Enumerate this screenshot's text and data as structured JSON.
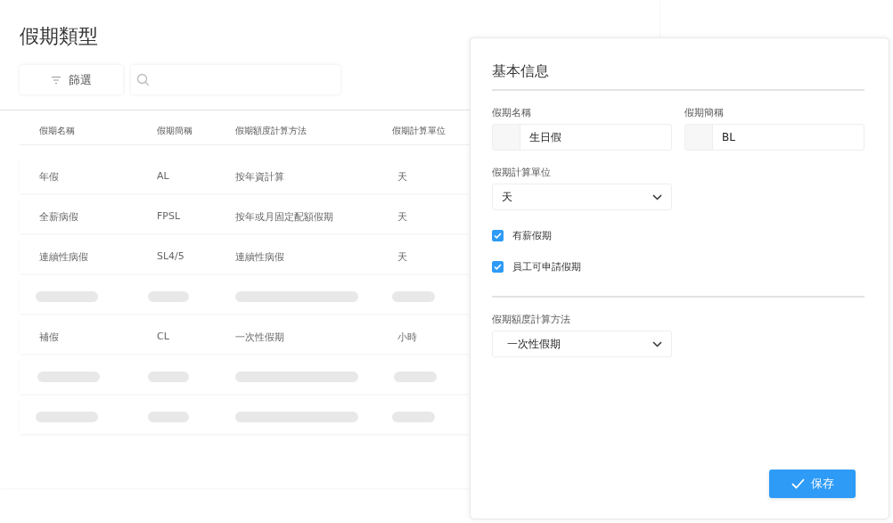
{
  "page": {
    "title": "假期類型",
    "filter_button": "篩選"
  },
  "table": {
    "columns": [
      "假期名稱",
      "假期簡稱",
      "假期額度計算方法",
      "假期計算單位"
    ],
    "rows": [
      {
        "kind": "data",
        "cells": [
          "年假",
          "AL",
          "按年資計算",
          "天"
        ]
      },
      {
        "kind": "data",
        "cells": [
          "全薪病假",
          "FPSL",
          "按年或月固定配額假期",
          "天"
        ]
      },
      {
        "kind": "data",
        "cells": [
          "連續性病假",
          "SL4/5",
          "連續性病假",
          "天"
        ]
      },
      {
        "kind": "skeleton"
      },
      {
        "kind": "data",
        "cells": [
          "補假",
          "CL",
          "一次性假期",
          "小時"
        ]
      },
      {
        "kind": "skeleton"
      },
      {
        "kind": "skeleton"
      }
    ]
  },
  "panel": {
    "title": "基本信息",
    "name_field": {
      "label": "假期名稱",
      "value": "生日假"
    },
    "short_field": {
      "label": "假期簡稱",
      "value": "BL"
    },
    "unit_select": {
      "label": "假期計算單位",
      "value": "天"
    },
    "checkboxes": [
      {
        "label": "有薪假期",
        "checked": true
      },
      {
        "label": "員工可申請假期",
        "checked": true
      }
    ],
    "method_select": {
      "label": "假期額度計算方法",
      "value": "一次性假期"
    },
    "save_button": "保存"
  }
}
